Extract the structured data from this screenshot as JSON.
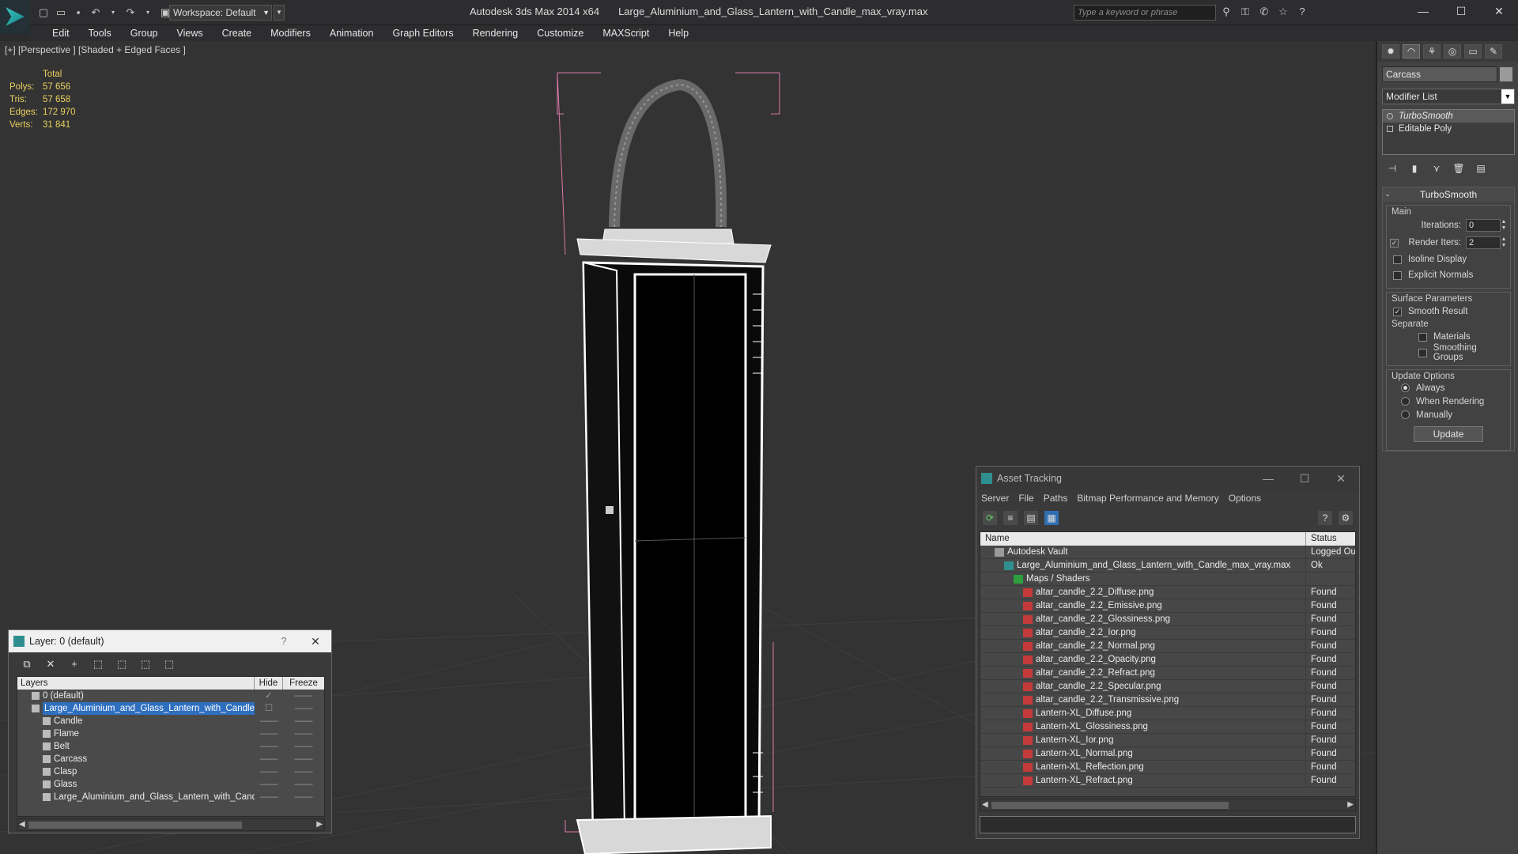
{
  "titlebar": {
    "workspace": "Workspace: Default",
    "app_name": "Autodesk 3ds Max  2014 x64",
    "file_name": "Large_Aluminium_and_Glass_Lantern_with_Candle_max_vray.max",
    "search_placeholder": "Type a keyword or phrase"
  },
  "menu": [
    "Edit",
    "Tools",
    "Group",
    "Views",
    "Create",
    "Modifiers",
    "Animation",
    "Graph Editors",
    "Rendering",
    "Customize",
    "MAXScript",
    "Help"
  ],
  "viewport": {
    "label": "[+] [Perspective ] [Shaded + Edged Faces ]",
    "stats": {
      "header": "Total",
      "polys_label": "Polys:",
      "polys": "57 656",
      "tris_label": "Tris:",
      "tris": "57 658",
      "edges_label": "Edges:",
      "edges": "172 970",
      "verts_label": "Verts:",
      "verts": "31 841"
    }
  },
  "command_panel": {
    "object_name": "Carcass",
    "modifier_list": "Modifier List",
    "stack": [
      "TurboSmooth",
      "Editable Poly"
    ],
    "rollout_title": "TurboSmooth",
    "main_group": "Main",
    "iterations_label": "Iterations:",
    "iterations": "0",
    "render_iters_label": "Render Iters:",
    "render_iters": "2",
    "isoline": "Isoline Display",
    "explicit_normals": "Explicit Normals",
    "surface_group": "Surface Parameters",
    "smooth_result": "Smooth Result",
    "separate": "Separate",
    "materials": "Materials",
    "smoothing_groups": "Smoothing Groups",
    "update_group": "Update Options",
    "always": "Always",
    "when_rendering": "When Rendering",
    "manually": "Manually",
    "update_button": "Update"
  },
  "asset_tracking": {
    "title": "Asset Tracking",
    "menu": [
      "Server",
      "File",
      "Paths",
      "Bitmap Performance and Memory",
      "Options"
    ],
    "col_name": "Name",
    "col_status": "Status",
    "rows": [
      {
        "name": "Autodesk Vault",
        "status": "Logged Ou",
        "icon": "vault",
        "indent": 0
      },
      {
        "name": "Large_Aluminium_and_Glass_Lantern_with_Candle_max_vray.max",
        "status": "Ok",
        "icon": "max",
        "indent": 1
      },
      {
        "name": "Maps / Shaders",
        "status": "",
        "icon": "maps",
        "indent": 2
      },
      {
        "name": "altar_candle_2.2_Diffuse.png",
        "status": "Found",
        "icon": "png",
        "indent": 3
      },
      {
        "name": "altar_candle_2.2_Emissive.png",
        "status": "Found",
        "icon": "png",
        "indent": 3
      },
      {
        "name": "altar_candle_2.2_Glossiness.png",
        "status": "Found",
        "icon": "png",
        "indent": 3
      },
      {
        "name": "altar_candle_2.2_Ior.png",
        "status": "Found",
        "icon": "png",
        "indent": 3
      },
      {
        "name": "altar_candle_2.2_Normal.png",
        "status": "Found",
        "icon": "png",
        "indent": 3
      },
      {
        "name": "altar_candle_2.2_Opacity.png",
        "status": "Found",
        "icon": "png",
        "indent": 3
      },
      {
        "name": "altar_candle_2.2_Refract.png",
        "status": "Found",
        "icon": "png",
        "indent": 3
      },
      {
        "name": "altar_candle_2.2_Specular.png",
        "status": "Found",
        "icon": "png",
        "indent": 3
      },
      {
        "name": "altar_candle_2.2_Transmissive.png",
        "status": "Found",
        "icon": "png",
        "indent": 3
      },
      {
        "name": "Lantern-XL_Diffuse.png",
        "status": "Found",
        "icon": "png",
        "indent": 3
      },
      {
        "name": "Lantern-XL_Glossiness.png",
        "status": "Found",
        "icon": "png",
        "indent": 3
      },
      {
        "name": "Lantern-XL_Ior.png",
        "status": "Found",
        "icon": "png",
        "indent": 3
      },
      {
        "name": "Lantern-XL_Normal.png",
        "status": "Found",
        "icon": "png",
        "indent": 3
      },
      {
        "name": "Lantern-XL_Reflection.png",
        "status": "Found",
        "icon": "png",
        "indent": 3
      },
      {
        "name": "Lantern-XL_Refract.png",
        "status": "Found",
        "icon": "png",
        "indent": 3
      }
    ]
  },
  "layer_window": {
    "title": "Layer: 0 (default)",
    "help": "?",
    "col_layers": "Layers",
    "col_hide": "Hide",
    "col_freeze": "Freeze",
    "rows": [
      {
        "name": "0 (default)",
        "indent": 1,
        "hide": "✓",
        "freeze": "——",
        "selected": false
      },
      {
        "name": "Large_Aluminium_and_Glass_Lantern_with_Candle",
        "indent": 1,
        "hide": "☐",
        "freeze": "——",
        "selected": true
      },
      {
        "name": "Candle",
        "indent": 2,
        "hide": "——",
        "freeze": "——",
        "selected": false
      },
      {
        "name": "Flame",
        "indent": 2,
        "hide": "——",
        "freeze": "——",
        "selected": false
      },
      {
        "name": "Belt",
        "indent": 2,
        "hide": "——",
        "freeze": "——",
        "selected": false
      },
      {
        "name": "Carcass",
        "indent": 2,
        "hide": "——",
        "freeze": "——",
        "selected": false
      },
      {
        "name": "Clasp",
        "indent": 2,
        "hide": "——",
        "freeze": "——",
        "selected": false
      },
      {
        "name": "Glass",
        "indent": 2,
        "hide": "——",
        "freeze": "——",
        "selected": false
      },
      {
        "name": "Large_Aluminium_and_Glass_Lantern_with_Candle",
        "indent": 2,
        "hide": "——",
        "freeze": "——",
        "selected": false
      }
    ]
  }
}
